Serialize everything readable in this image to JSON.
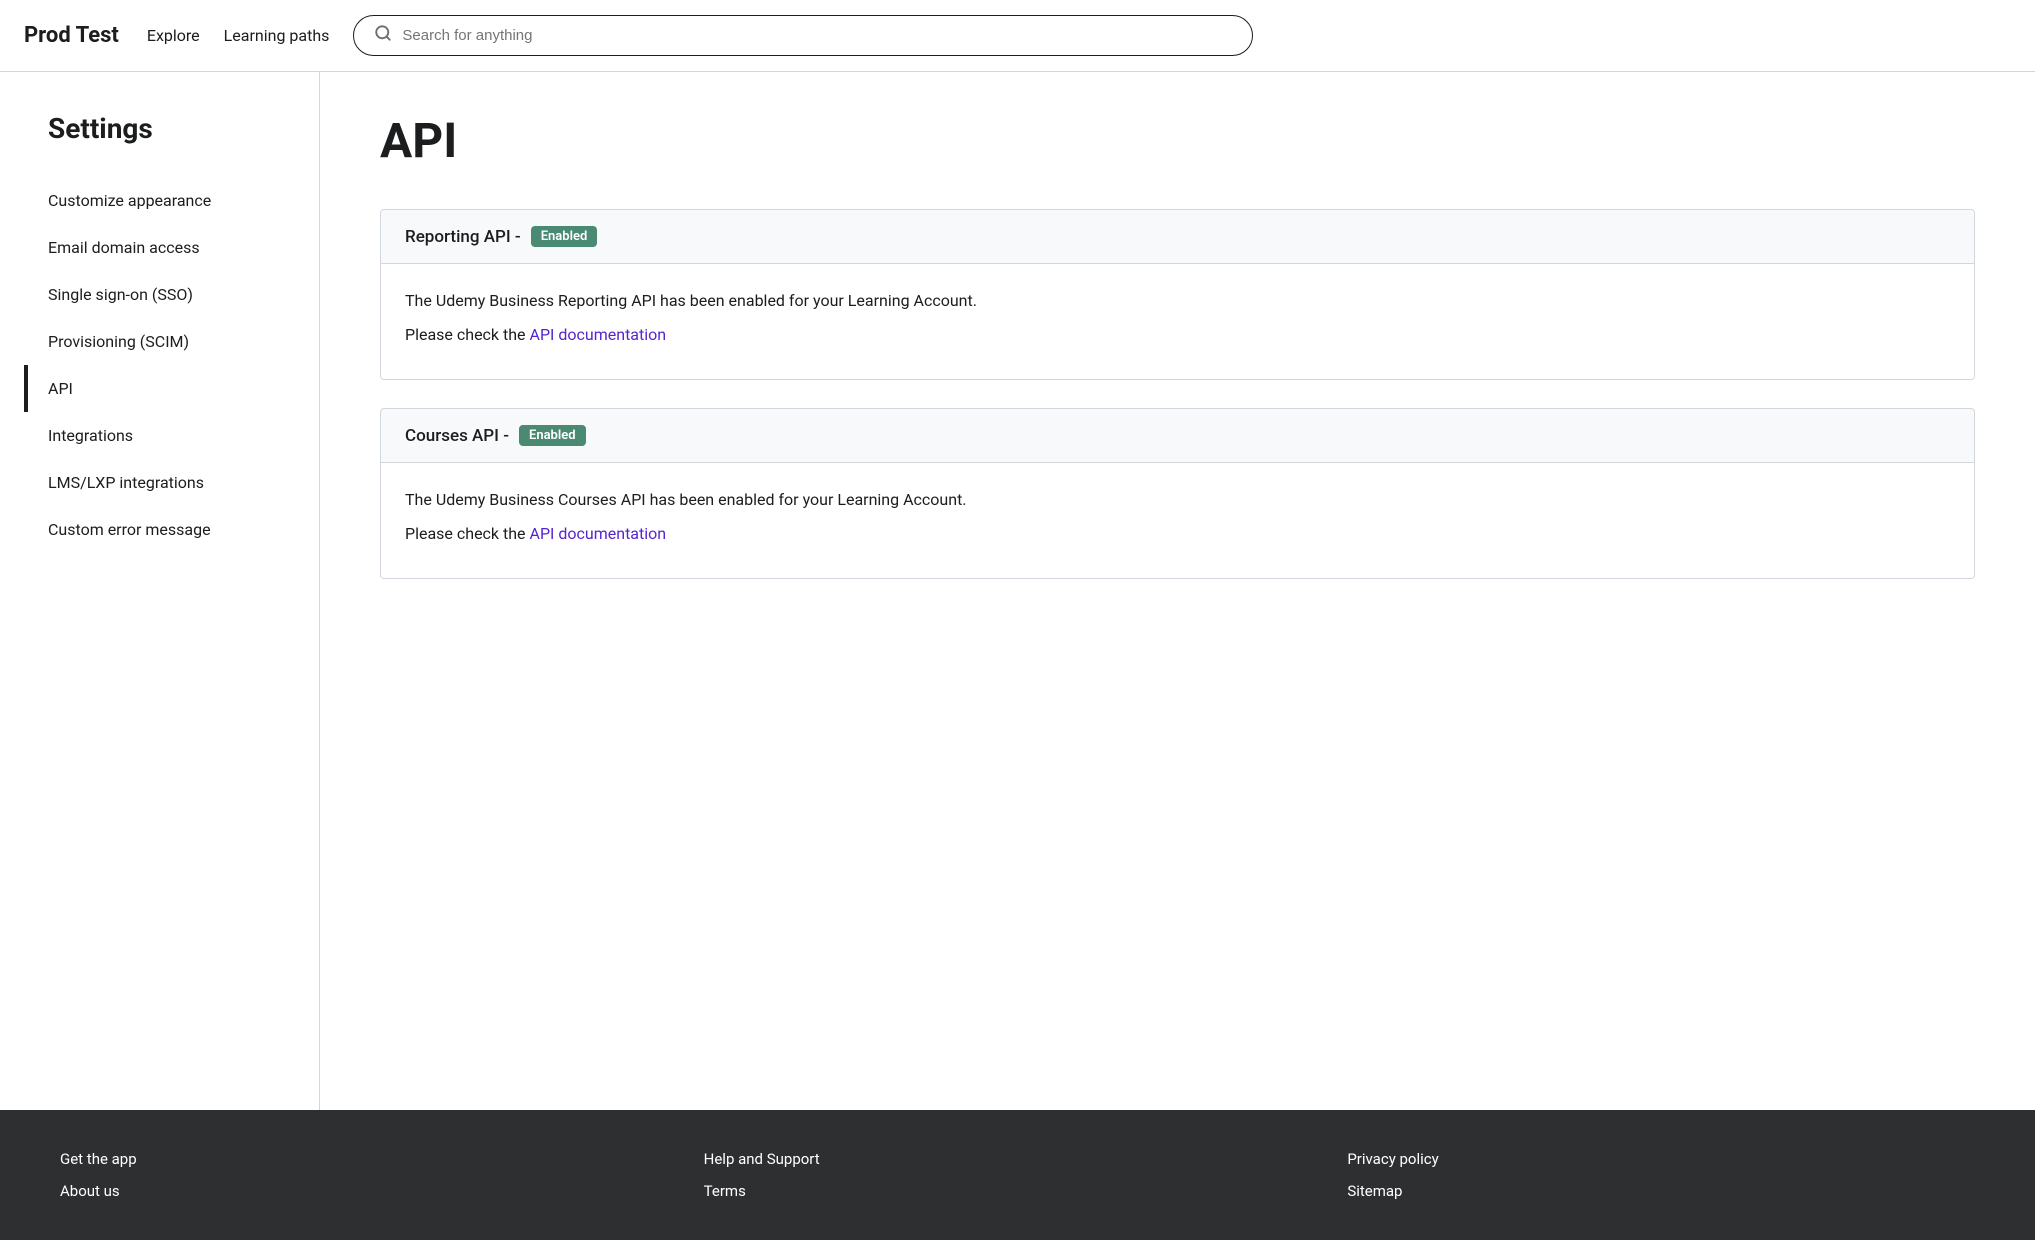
{
  "header": {
    "logo": "Prod Test",
    "nav": [
      {
        "label": "Explore",
        "id": "explore"
      },
      {
        "label": "Learning paths",
        "id": "learning-paths"
      }
    ],
    "search_placeholder": "Search for anything"
  },
  "sidebar": {
    "title": "Settings",
    "items": [
      {
        "label": "Customize appearance",
        "id": "customize-appearance",
        "active": false
      },
      {
        "label": "Email domain access",
        "id": "email-domain-access",
        "active": false
      },
      {
        "label": "Single sign-on (SSO)",
        "id": "single-sign-on",
        "active": false
      },
      {
        "label": "Provisioning (SCIM)",
        "id": "provisioning-scim",
        "active": false
      },
      {
        "label": "API",
        "id": "api",
        "active": true
      },
      {
        "label": "Integrations",
        "id": "integrations",
        "active": false
      },
      {
        "label": "LMS/LXP integrations",
        "id": "lms-lxp-integrations",
        "active": false
      },
      {
        "label": "Custom error message",
        "id": "custom-error-message",
        "active": false
      }
    ]
  },
  "content": {
    "page_title": "API",
    "cards": [
      {
        "id": "reporting-api",
        "header_text": "Reporting API -",
        "badge": "Enabled",
        "body_line1": "The Udemy Business Reporting API has been enabled for your Learning Account.",
        "body_line2_prefix": "Please check the ",
        "body_link_text": "API documentation",
        "body_link_href": "#"
      },
      {
        "id": "courses-api",
        "header_text": "Courses API -",
        "badge": "Enabled",
        "body_line1": "The Udemy Business Courses API has been enabled for your Learning Account.",
        "body_line2_prefix": "Please check the ",
        "body_link_text": "API documentation",
        "body_link_href": "#"
      }
    ]
  },
  "footer": {
    "columns": [
      {
        "links": [
          {
            "label": "Get the app",
            "id": "get-the-app"
          },
          {
            "label": "About us",
            "id": "about-us"
          }
        ]
      },
      {
        "links": [
          {
            "label": "Help and Support",
            "id": "help-and-support"
          },
          {
            "label": "Terms",
            "id": "terms"
          }
        ]
      },
      {
        "links": [
          {
            "label": "Privacy policy",
            "id": "privacy-policy"
          },
          {
            "label": "Sitemap",
            "id": "sitemap"
          }
        ]
      }
    ]
  }
}
